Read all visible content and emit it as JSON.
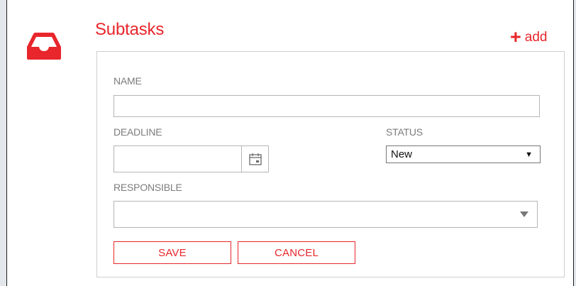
{
  "header": {
    "title": "Subtasks",
    "add_label": "add",
    "add_icon": "plus-icon",
    "section_icon": "inbox-tray-icon"
  },
  "form": {
    "name_label": "NAME",
    "name_value": "",
    "deadline_label": "DEADLINE",
    "deadline_value": "",
    "calendar_icon": "calendar-icon",
    "status_label": "STATUS",
    "status_value": "New",
    "responsible_label": "RESPONSIBLE",
    "responsible_value": "",
    "save_label": "SAVE",
    "cancel_label": "CANCEL"
  },
  "colors": {
    "accent": "#e8262b",
    "label": "#7c7c7c",
    "border": "#b5b5b5",
    "background": "#e3e6ea"
  }
}
